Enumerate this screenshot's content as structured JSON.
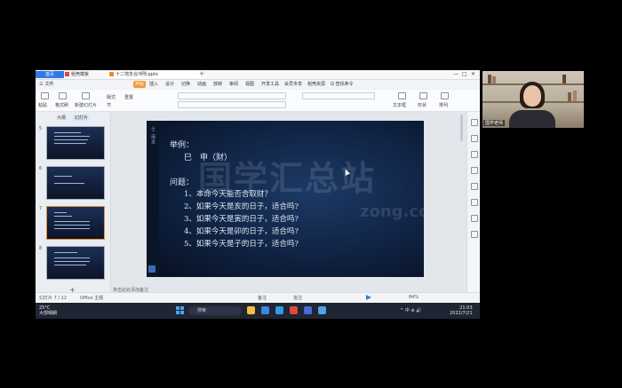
{
  "window": {
    "tab_home": "首页",
    "tab_doc1": "稻壳模板",
    "tab_doc2": "十二地支合冲刑.pptx",
    "tab_plus": "+"
  },
  "menu": {
    "items": [
      "三 文件",
      "开始",
      "插入",
      "设计",
      "切换",
      "动画",
      "放映",
      "审阅",
      "视图",
      "开发工具",
      "会员专享",
      "稻壳资源",
      "Q 查找命令"
    ],
    "active_index": 1
  },
  "ribbon": {
    "paste_label": "粘贴",
    "format_painter": "格式刷",
    "new_slide": "新建幻灯片",
    "layout": "版式",
    "section": "节",
    "reset": "重置",
    "text_box": "文本框",
    "shapes": "形状",
    "arrange": "排列"
  },
  "left_pane": {
    "tab_outline": "大纲",
    "tab_slides": "幻灯片",
    "thumb_numbers": [
      "5",
      "6",
      "7",
      "8"
    ],
    "selected_index": 2,
    "add_label": "+"
  },
  "slide": {
    "side_label": "十二地支",
    "heading": "举例：",
    "example": "巳　申（财）",
    "question_label": "问题：",
    "questions": [
      "1、本命今天能否合取财？",
      "2、如果今天是亥的日子，适合吗?",
      "3、如果今天是寅的日子，适合吗?",
      "4、如果今天是卯的日子，适合吗?",
      "5、如果今天是子的日子，适合吗?"
    ],
    "watermark": "国学汇总站",
    "watermark_url": "zong.com"
  },
  "notes": {
    "placeholder": "单击此处添加备注"
  },
  "statusbar": {
    "slide_info": "幻灯片 7 / 12",
    "theme": "Office 主题",
    "notes_btn": "备注",
    "comment_btn": "批注",
    "zoom": "84%"
  },
  "taskbar": {
    "weather_temp": "25°C",
    "weather_desc": "大部晴朗",
    "search_placeholder": "搜索",
    "tray": "^ 中 ⊕ 🔊",
    "time": "21:03",
    "date": "2022/7/21"
  },
  "webcam": {
    "label": "国学老师"
  }
}
